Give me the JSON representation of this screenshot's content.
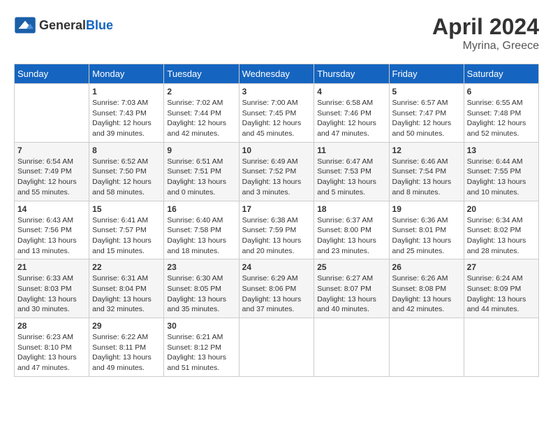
{
  "header": {
    "logo_general": "General",
    "logo_blue": "Blue",
    "month_year": "April 2024",
    "location": "Myrina, Greece"
  },
  "days_of_week": [
    "Sunday",
    "Monday",
    "Tuesday",
    "Wednesday",
    "Thursday",
    "Friday",
    "Saturday"
  ],
  "weeks": [
    [
      {
        "day": "",
        "info": ""
      },
      {
        "day": "1",
        "info": "Sunrise: 7:03 AM\nSunset: 7:43 PM\nDaylight: 12 hours\nand 39 minutes."
      },
      {
        "day": "2",
        "info": "Sunrise: 7:02 AM\nSunset: 7:44 PM\nDaylight: 12 hours\nand 42 minutes."
      },
      {
        "day": "3",
        "info": "Sunrise: 7:00 AM\nSunset: 7:45 PM\nDaylight: 12 hours\nand 45 minutes."
      },
      {
        "day": "4",
        "info": "Sunrise: 6:58 AM\nSunset: 7:46 PM\nDaylight: 12 hours\nand 47 minutes."
      },
      {
        "day": "5",
        "info": "Sunrise: 6:57 AM\nSunset: 7:47 PM\nDaylight: 12 hours\nand 50 minutes."
      },
      {
        "day": "6",
        "info": "Sunrise: 6:55 AM\nSunset: 7:48 PM\nDaylight: 12 hours\nand 52 minutes."
      }
    ],
    [
      {
        "day": "7",
        "info": "Sunrise: 6:54 AM\nSunset: 7:49 PM\nDaylight: 12 hours\nand 55 minutes."
      },
      {
        "day": "8",
        "info": "Sunrise: 6:52 AM\nSunset: 7:50 PM\nDaylight: 12 hours\nand 58 minutes."
      },
      {
        "day": "9",
        "info": "Sunrise: 6:51 AM\nSunset: 7:51 PM\nDaylight: 13 hours\nand 0 minutes."
      },
      {
        "day": "10",
        "info": "Sunrise: 6:49 AM\nSunset: 7:52 PM\nDaylight: 13 hours\nand 3 minutes."
      },
      {
        "day": "11",
        "info": "Sunrise: 6:47 AM\nSunset: 7:53 PM\nDaylight: 13 hours\nand 5 minutes."
      },
      {
        "day": "12",
        "info": "Sunrise: 6:46 AM\nSunset: 7:54 PM\nDaylight: 13 hours\nand 8 minutes."
      },
      {
        "day": "13",
        "info": "Sunrise: 6:44 AM\nSunset: 7:55 PM\nDaylight: 13 hours\nand 10 minutes."
      }
    ],
    [
      {
        "day": "14",
        "info": "Sunrise: 6:43 AM\nSunset: 7:56 PM\nDaylight: 13 hours\nand 13 minutes."
      },
      {
        "day": "15",
        "info": "Sunrise: 6:41 AM\nSunset: 7:57 PM\nDaylight: 13 hours\nand 15 minutes."
      },
      {
        "day": "16",
        "info": "Sunrise: 6:40 AM\nSunset: 7:58 PM\nDaylight: 13 hours\nand 18 minutes."
      },
      {
        "day": "17",
        "info": "Sunrise: 6:38 AM\nSunset: 7:59 PM\nDaylight: 13 hours\nand 20 minutes."
      },
      {
        "day": "18",
        "info": "Sunrise: 6:37 AM\nSunset: 8:00 PM\nDaylight: 13 hours\nand 23 minutes."
      },
      {
        "day": "19",
        "info": "Sunrise: 6:36 AM\nSunset: 8:01 PM\nDaylight: 13 hours\nand 25 minutes."
      },
      {
        "day": "20",
        "info": "Sunrise: 6:34 AM\nSunset: 8:02 PM\nDaylight: 13 hours\nand 28 minutes."
      }
    ],
    [
      {
        "day": "21",
        "info": "Sunrise: 6:33 AM\nSunset: 8:03 PM\nDaylight: 13 hours\nand 30 minutes."
      },
      {
        "day": "22",
        "info": "Sunrise: 6:31 AM\nSunset: 8:04 PM\nDaylight: 13 hours\nand 32 minutes."
      },
      {
        "day": "23",
        "info": "Sunrise: 6:30 AM\nSunset: 8:05 PM\nDaylight: 13 hours\nand 35 minutes."
      },
      {
        "day": "24",
        "info": "Sunrise: 6:29 AM\nSunset: 8:06 PM\nDaylight: 13 hours\nand 37 minutes."
      },
      {
        "day": "25",
        "info": "Sunrise: 6:27 AM\nSunset: 8:07 PM\nDaylight: 13 hours\nand 40 minutes."
      },
      {
        "day": "26",
        "info": "Sunrise: 6:26 AM\nSunset: 8:08 PM\nDaylight: 13 hours\nand 42 minutes."
      },
      {
        "day": "27",
        "info": "Sunrise: 6:24 AM\nSunset: 8:09 PM\nDaylight: 13 hours\nand 44 minutes."
      }
    ],
    [
      {
        "day": "28",
        "info": "Sunrise: 6:23 AM\nSunset: 8:10 PM\nDaylight: 13 hours\nand 47 minutes."
      },
      {
        "day": "29",
        "info": "Sunrise: 6:22 AM\nSunset: 8:11 PM\nDaylight: 13 hours\nand 49 minutes."
      },
      {
        "day": "30",
        "info": "Sunrise: 6:21 AM\nSunset: 8:12 PM\nDaylight: 13 hours\nand 51 minutes."
      },
      {
        "day": "",
        "info": ""
      },
      {
        "day": "",
        "info": ""
      },
      {
        "day": "",
        "info": ""
      },
      {
        "day": "",
        "info": ""
      }
    ]
  ]
}
